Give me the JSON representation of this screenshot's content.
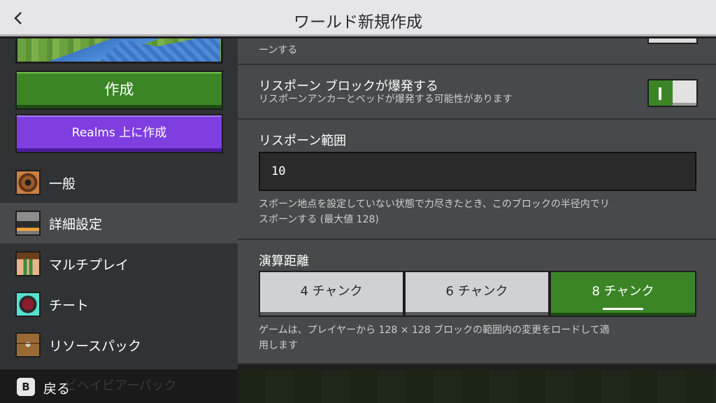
{
  "header": {
    "title": "ワールド新規作成",
    "back_icon": "chevron-left-icon"
  },
  "left": {
    "create_label": "作成",
    "realms_label": "Realms 上に作成",
    "nav": [
      {
        "label": "一般",
        "icon": "gear-icon",
        "active": false
      },
      {
        "label": "詳細設定",
        "icon": "furnace-icon",
        "active": true
      },
      {
        "label": "マルチプレイ",
        "icon": "player-face-icon",
        "active": false
      },
      {
        "label": "チート",
        "icon": "command-block-icon",
        "active": false
      },
      {
        "label": "リソースパック",
        "icon": "chest-icon",
        "active": false
      }
    ],
    "hidden_item": "ビヘイビアーパック"
  },
  "settings": {
    "top_partial_text": "ーンする",
    "respawn_block": {
      "title": "リスポーン ブロックが爆発する",
      "desc": "リスポーンアンカーとベッドが爆発する可能性があります",
      "toggle_on": true
    },
    "respawn_range": {
      "title": "リスポーン範囲",
      "value": "10",
      "desc_line1": "スポーン地点を設定していない状態で力尽きたとき、このブロックの半径内でリ",
      "desc_line2": "スポーンする (最大値 128)"
    },
    "simulation": {
      "title": "演算距離",
      "options": [
        "4 チャンク",
        "6 チャンク",
        "8 チャンク"
      ],
      "selected": "8 チャンク",
      "desc_line1": "ゲームは、プレイヤーから 128 × 128 ブロックの範囲内の変更をロードして適",
      "desc_line2": "用します"
    }
  },
  "bottom": {
    "key": "B",
    "label": "戻る"
  },
  "colors": {
    "accent_green": "#3c8527",
    "realms_purple": "#7f3fe0"
  }
}
